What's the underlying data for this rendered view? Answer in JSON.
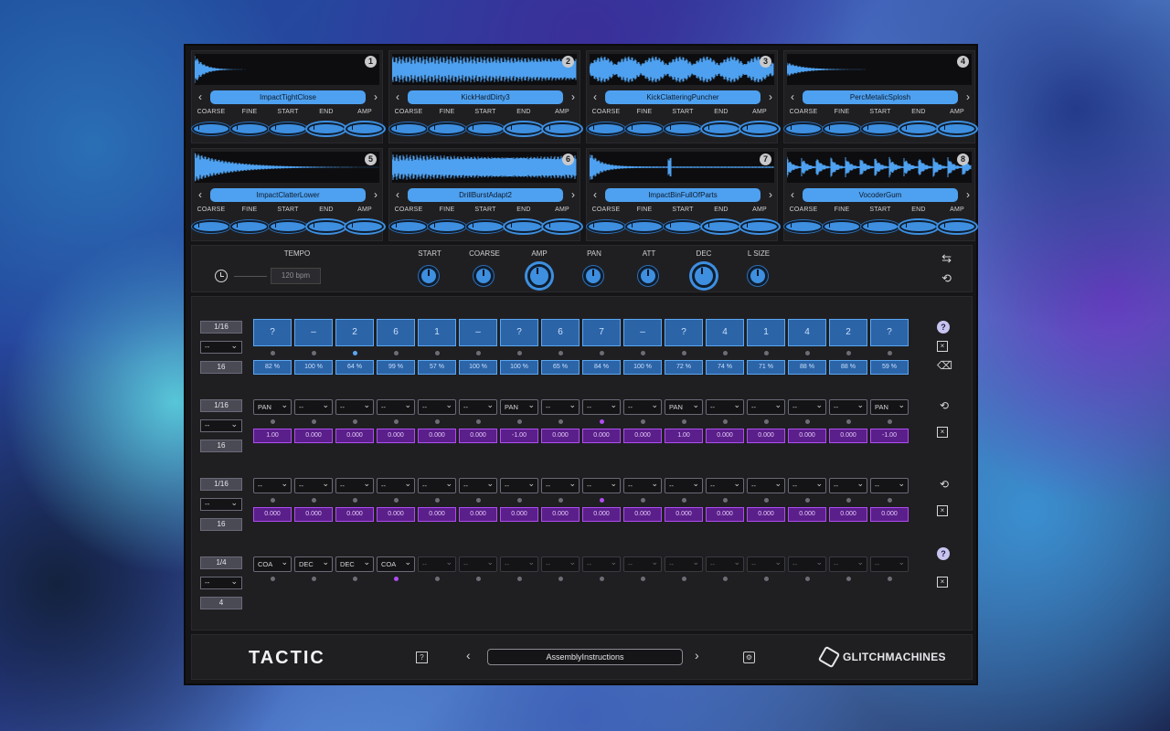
{
  "slots": [
    {
      "num": "1",
      "name": "ImpactTightClose"
    },
    {
      "num": "2",
      "name": "KickHardDirty3"
    },
    {
      "num": "3",
      "name": "KickClatteringPuncher"
    },
    {
      "num": "4",
      "name": "PercMetalicSplosh"
    },
    {
      "num": "5",
      "name": "ImpactClatterLower"
    },
    {
      "num": "6",
      "name": "DrillBurstAdapt2"
    },
    {
      "num": "7",
      "name": "ImpactBinFullOfParts"
    },
    {
      "num": "8",
      "name": "VocoderGum"
    }
  ],
  "slot_knob_labels": [
    "COARSE",
    "FINE",
    "START",
    "END",
    "AMP"
  ],
  "nav": {
    "prev": "‹",
    "next": "›"
  },
  "macro": {
    "tempo_label": "TEMPO",
    "tempo_value": "120 bpm",
    "knobs": [
      "START",
      "COARSE",
      "AMP",
      "PAN",
      "ATT",
      "DEC",
      "L SIZE"
    ],
    "side_icons": [
      "⇆",
      "⟲"
    ]
  },
  "lanes": [
    {
      "division": "1/16",
      "mode": "--",
      "length": "16",
      "pads": [
        "?",
        "–",
        "2",
        "6",
        "1",
        "–",
        "?",
        "6",
        "7",
        "–",
        "?",
        "4",
        "1",
        "4",
        "2",
        "?"
      ],
      "values": [
        "82 %",
        "100 %",
        "64 %",
        "99 %",
        "57 %",
        "100 %",
        "100 %",
        "65 %",
        "84 %",
        "100 %",
        "72 %",
        "74 %",
        "71 %",
        "88 %",
        "88 %",
        "59 %"
      ]
    },
    {
      "division": "1/16",
      "mode": "--",
      "length": "16",
      "params": [
        "PAN",
        "--",
        "--",
        "--",
        "--",
        "--",
        "PAN",
        "--",
        "--",
        "--",
        "PAN",
        "--",
        "--",
        "--",
        "--",
        "PAN"
      ],
      "values": [
        "1.00",
        "0.000",
        "0.000",
        "0.000",
        "0.000",
        "0.000",
        "-1.00",
        "0.000",
        "0.000",
        "0.000",
        "1.00",
        "0.000",
        "0.000",
        "0.000",
        "0.000",
        "-1.00"
      ]
    },
    {
      "division": "1/16",
      "mode": "--",
      "length": "16",
      "params": [
        "--",
        "--",
        "--",
        "--",
        "--",
        "--",
        "--",
        "--",
        "--",
        "--",
        "--",
        "--",
        "--",
        "--",
        "--",
        "--"
      ],
      "values": [
        "0.000",
        "0.000",
        "0.000",
        "0.000",
        "0.000",
        "0.000",
        "0.000",
        "0.000",
        "0.000",
        "0.000",
        "0.000",
        "0.000",
        "0.000",
        "0.000",
        "0.000",
        "0.000"
      ]
    },
    {
      "division": "1/4",
      "mode": "--",
      "length": "4",
      "params": [
        "COA",
        "DEC",
        "DEC",
        "COA",
        "--",
        "--",
        "--",
        "--",
        "--",
        "--",
        "--",
        "--",
        "--",
        "--",
        "--",
        "--"
      ]
    }
  ],
  "bottom": {
    "brand": "TACTIC",
    "help": "?",
    "prev": "‹",
    "next": "›",
    "preset": "AssemblyInstructions",
    "settings": "⚙",
    "maker": "GLITCHMACHINES"
  },
  "colors": {
    "accent_blue": "#4ea1f0",
    "accent_purple": "#b04cf0",
    "panel": "#1f1f22"
  }
}
